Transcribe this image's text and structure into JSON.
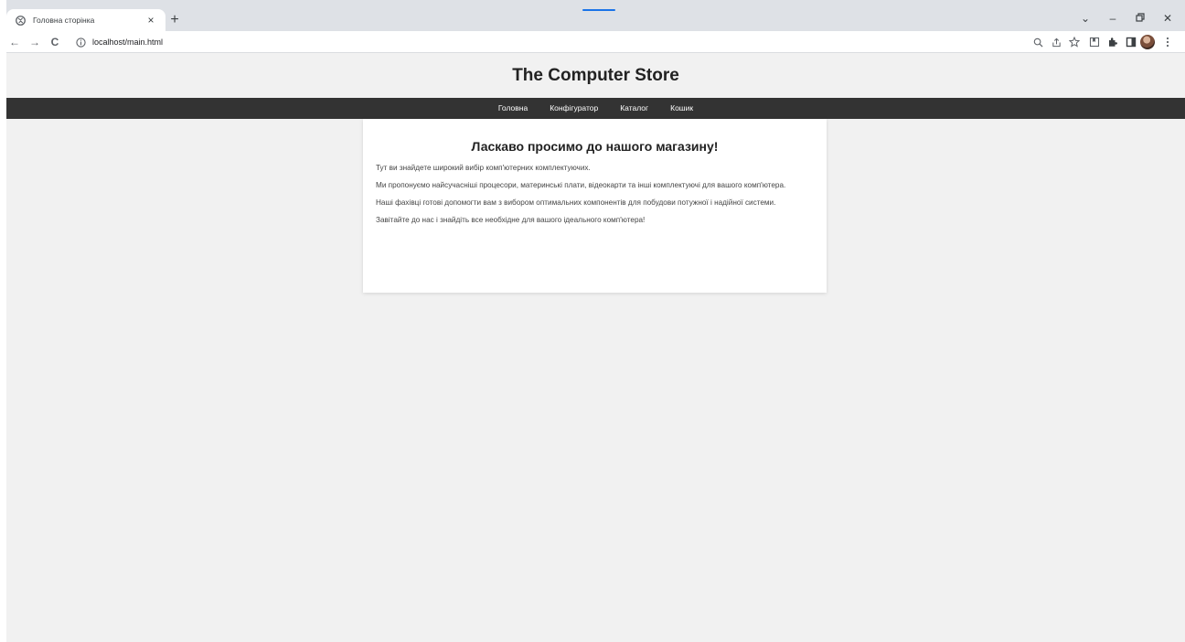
{
  "browser": {
    "tab_title": "Головна сторінка",
    "tab_close": "×",
    "new_tab": "+",
    "url": "localhost/main.html",
    "accent_color": "#1a73e8",
    "window_controls": {
      "tab_search": "⌄",
      "minimize": "–",
      "restore": "🗗",
      "close": "✕"
    },
    "nav": {
      "back": "←",
      "forward": "→",
      "reload": "C"
    },
    "toolbar_icons": [
      "zoom-icon",
      "share-icon",
      "bookmark-star-icon",
      "reading-list-icon",
      "extensions-icon",
      "side-panel-icon",
      "profile-avatar",
      "menu-icon"
    ]
  },
  "site": {
    "title": "The Computer Store",
    "nav_bar_color": "#333333",
    "nav": [
      {
        "label": "Головна"
      },
      {
        "label": "Конфігуратор"
      },
      {
        "label": "Каталог"
      },
      {
        "label": "Кошик"
      }
    ]
  },
  "content": {
    "heading": "Ласкаво просимо до нашого магазину!",
    "paragraphs": [
      "Тут ви знайдете широкий вибір комп'ютерних комплектуючих.",
      "Ми пропонуємо найсучасніші процесори, материнські плати, відеокарти та інші комплектуючі для вашого комп'ютера.",
      "Наші фахівці готові допомогти вам з вибором оптимальних компонентів для побудови потужної і надійної системи.",
      "Завітайте до нас і знайдіть все необхідне для вашого ідеального комп'ютера!"
    ]
  }
}
